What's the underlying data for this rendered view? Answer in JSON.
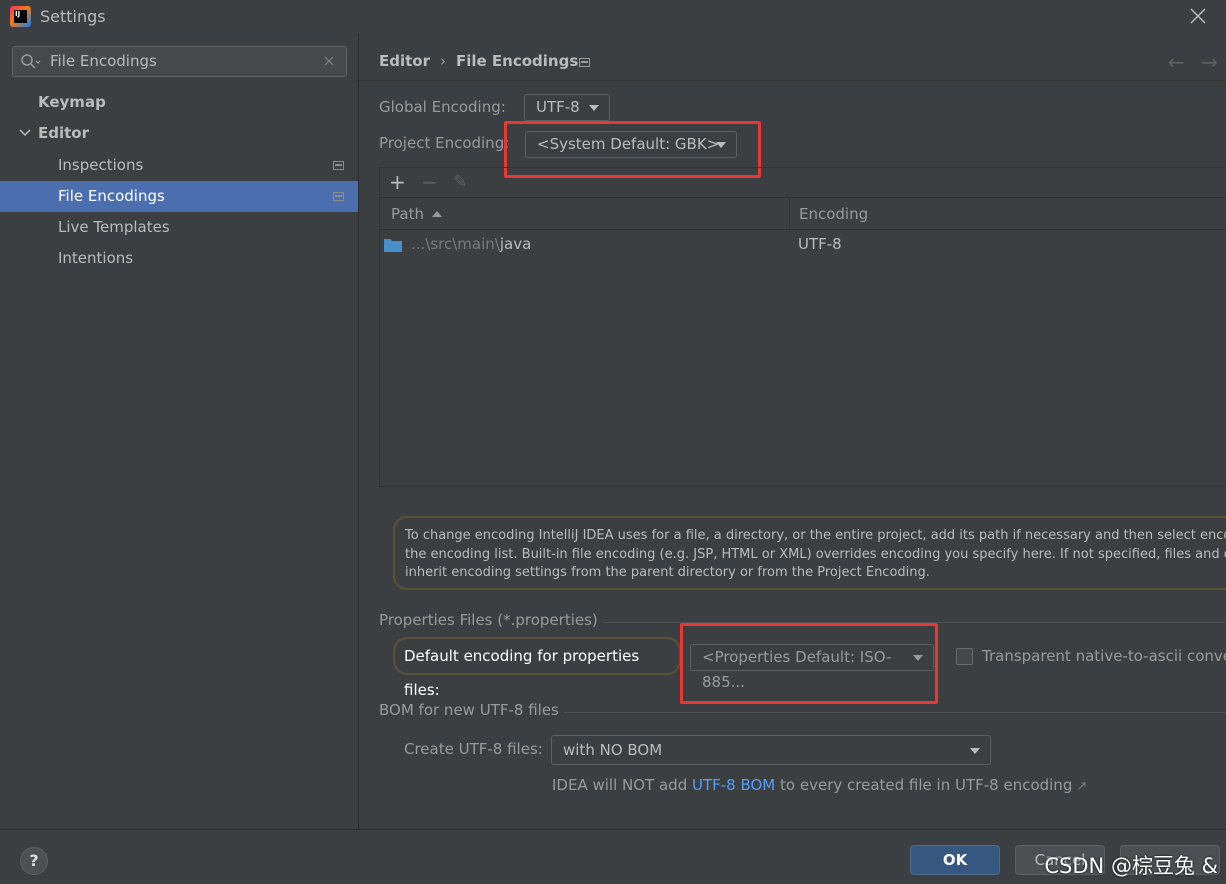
{
  "window": {
    "title": "Settings",
    "logo_text": "IJ"
  },
  "search": {
    "value": "File Encodings"
  },
  "sidebar": {
    "items": [
      {
        "label": "Keymap"
      },
      {
        "label": "Editor"
      },
      {
        "label": "Inspections"
      },
      {
        "label": "File Encodings"
      },
      {
        "label": "Live Templates"
      },
      {
        "label": "Intentions"
      }
    ]
  },
  "breadcrumb": {
    "parent": "Editor",
    "separator": "›",
    "current": "File Encodings"
  },
  "nav_arrows": {
    "back": "←",
    "forward": "→"
  },
  "global_encoding": {
    "label": "Global Encoding:",
    "value": "UTF-8"
  },
  "project_encoding": {
    "label": "Project Encoding:",
    "value": "<System Default: GBK>"
  },
  "table_toolbar": {
    "add": "+",
    "remove": "−",
    "edit": "✎"
  },
  "table": {
    "columns": [
      "Path",
      "Encoding"
    ],
    "rows": [
      {
        "path_prefix": "...\\src\\main\\",
        "path_name": "java",
        "encoding": "UTF-8"
      }
    ]
  },
  "info_text": {
    "line1": "To change encoding IntelliJ IDEA uses for a file, a directory, or the entire project, add its path if necessary and then select encoding from",
    "line2": "the encoding list. Built-in file encoding (e.g. JSP, HTML or XML) overrides encoding you specify here. If not specified, files and directories",
    "line3": "inherit encoding settings from the parent directory or from the Project Encoding."
  },
  "properties": {
    "section_title": "Properties Files (*.properties)",
    "default_label": "Default encoding for properties files:",
    "default_value": "<Properties Default: ISO-885...",
    "transparent_label": "Transparent native-to-ascii conversion"
  },
  "bom": {
    "section_title": "BOM for new UTF-8 files",
    "create_label": "Create UTF-8 files:",
    "create_value": "with NO BOM",
    "note_prefix": "IDEA will NOT add ",
    "note_link": "UTF-8 BOM",
    "note_suffix": " to every created file in UTF-8 encoding",
    "note_ext": "↗"
  },
  "footer": {
    "help": "?",
    "ok": "OK",
    "cancel": "Cancel",
    "watermark": "CSDN @棕豆兔 &"
  },
  "colors": {
    "accent": "#4b6eaf",
    "highlight_box": "#e53935",
    "link": "#589df6",
    "ok_button": "#365880"
  }
}
